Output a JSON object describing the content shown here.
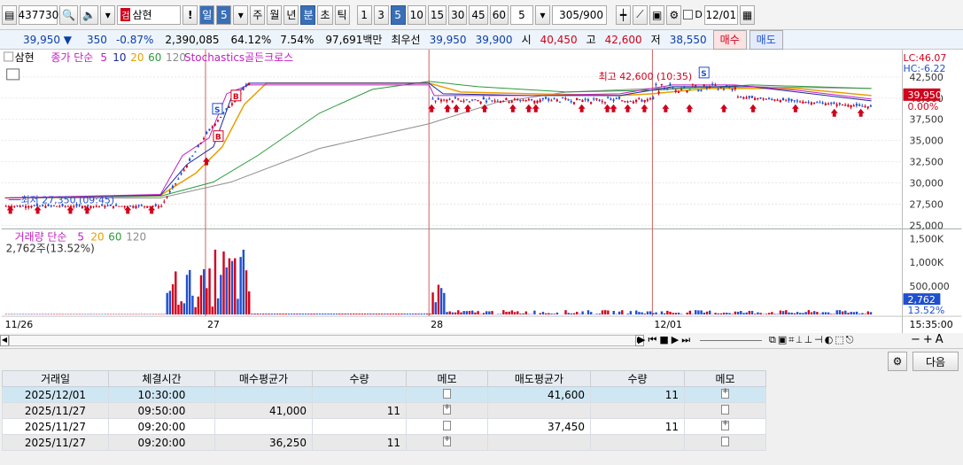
{
  "toolbar": {
    "code": "437730",
    "stock_name": "삼현",
    "badge": "검",
    "interval_main": "일",
    "interval_num": "5",
    "periods": [
      "주",
      "월",
      "년",
      "분",
      "초",
      "틱"
    ],
    "period_selected": "분",
    "minutes": [
      "1",
      "3",
      "5",
      "10",
      "15",
      "30",
      "45",
      "60"
    ],
    "minute_selected": "5",
    "combo_value": "5",
    "count": "305",
    "count_total": "/900",
    "date_check_label": "D",
    "date_value": "12/01"
  },
  "quote": {
    "price": "39,950 ▼",
    "change": "350",
    "change_pct": "-0.87%",
    "volume": "2,390,085",
    "vol_ratio": "64.12%",
    "turnover": "7.54%",
    "amount": "97,691백만",
    "best_label": "최우선",
    "best_sell": "39,950",
    "best_buy": "39,900",
    "open_label": "시",
    "open": "40,450",
    "high_label": "고",
    "high": "42,600",
    "low_label": "저",
    "low": "38,550",
    "buy_btn": "매수",
    "sell_btn": "매도"
  },
  "legend": {
    "name": "삼현",
    "price_label": "종가 단순",
    "ma": [
      "5",
      "10",
      "20",
      "60",
      "120"
    ],
    "indicator": "Stochastics골든크로스",
    "lc": "LC:46.07",
    "hc": "HC:-6.22",
    "vol_label": "거래량 단순",
    "vol_ma": [
      "5",
      "20",
      "60",
      "120"
    ],
    "vol_value": "2,762주(13.52%)"
  },
  "annotations": {
    "low_text": "최저 27,350 (09:45)",
    "high_text": "최고 42,600 (10:35)",
    "last_price": "39,950",
    "last_pct": "0.00%",
    "last_vol": "2,762",
    "last_vol_pct": "13.52%"
  },
  "axes": {
    "price_ticks": [
      "42,500",
      "40,000",
      "37,500",
      "35,000",
      "32,500",
      "30,000",
      "27,500",
      "25,000"
    ],
    "vol_ticks": [
      "1,500K",
      "1,000K",
      "500,000"
    ],
    "x_ticks": [
      "11/26",
      "27",
      "28",
      "12/01"
    ],
    "time_end": "15:35:00"
  },
  "table": {
    "headers": [
      "거래일",
      "체결시간",
      "매수평균가",
      "수량",
      "메모",
      "매도평균가",
      "수량",
      "메모"
    ],
    "rows": [
      {
        "date": "2025/12/01",
        "time": "10:30:00",
        "buy": "",
        "bqty": "",
        "bmemo": "doc",
        "sell": "41,600",
        "sqty": "11",
        "smemo": "doc-plus"
      },
      {
        "date": "2025/11/27",
        "time": "09:50:00",
        "buy": "41,000",
        "bqty": "11",
        "bmemo": "doc-plus",
        "sell": "",
        "sqty": "",
        "smemo": "doc"
      },
      {
        "date": "2025/11/27",
        "time": "09:20:00",
        "buy": "",
        "bqty": "",
        "bmemo": "doc",
        "sell": "37,450",
        "sqty": "11",
        "smemo": "doc-plus"
      },
      {
        "date": "2025/11/27",
        "time": "09:20:00",
        "buy": "36,250",
        "bqty": "11",
        "bmemo": "doc-plus",
        "sell": "",
        "sqty": "",
        "smemo": "doc"
      }
    ],
    "next_button": "다음"
  },
  "colors": {
    "up": "#d0021b",
    "down": "#1f4fd0",
    "accent": "#3a6fb6"
  }
}
